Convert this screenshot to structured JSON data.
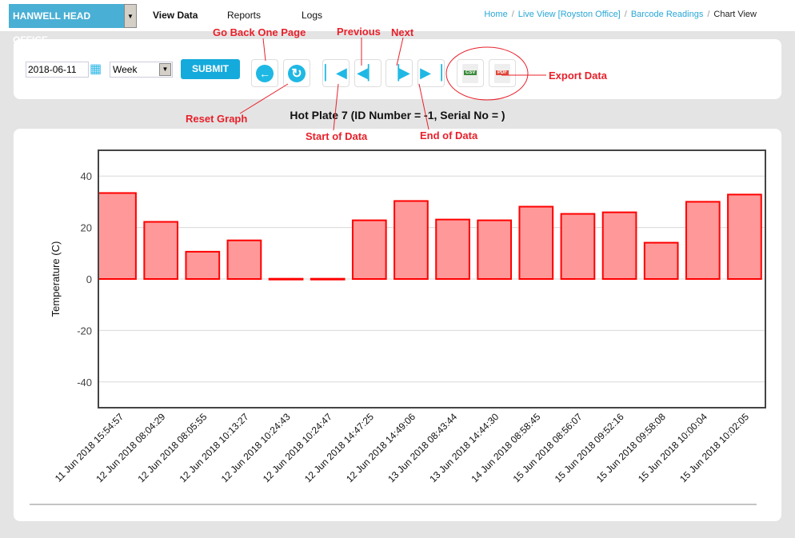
{
  "header": {
    "site": "HANWELL HEAD OFFICE",
    "nav": [
      "View Data",
      "Reports",
      "Logs"
    ],
    "breadcrumb": [
      "Home",
      "Live View [Royston Office]",
      "Barcode Readings",
      "Chart View"
    ]
  },
  "toolbar": {
    "date": "2018-06-11",
    "period": "Week",
    "submit": "SUBMIT",
    "csv": "CSV",
    "pdf": "PDF"
  },
  "annotations": {
    "back": "Go Back One Page",
    "previous": "Previous",
    "next": "Next",
    "export": "Export Data",
    "reset": "Reset Graph",
    "start": "Start of Data",
    "end": "End of Data"
  },
  "chart_data": {
    "type": "bar",
    "title": "Hot Plate 7 (ID Number = -1, Serial No = )",
    "ylabel": "Temperature (C)",
    "xlabel": "",
    "ylim": [
      -50,
      50
    ],
    "yticks": [
      40,
      20,
      0,
      -20,
      -40
    ],
    "grid": true,
    "color": "#ff9999",
    "edge": "#ff0000",
    "categories": [
      "11 Jun 2018 15:54:57",
      "12 Jun 2018 08:04:29",
      "12 Jun 2018 08:05:55",
      "12 Jun 2018 10:13:27",
      "12 Jun 2018 10:24:43",
      "12 Jun 2018 10:24:47",
      "12 Jun 2018 14:47:25",
      "12 Jun 2018 14:49:06",
      "13 Jun 2018 08:43:44",
      "13 Jun 2018 14:44:30",
      "14 Jun 2018 08:58:45",
      "15 Jun 2018 08:56:07",
      "15 Jun 2018 09:52:16",
      "15 Jun 2018 09:58:08",
      "15 Jun 2018 10:00:04",
      "15 Jun 2018 10:02:05"
    ],
    "values": [
      33.4,
      22.2,
      10.6,
      15.0,
      0.1,
      0.1,
      22.8,
      30.3,
      23.1,
      22.8,
      28.1,
      25.3,
      25.9,
      14.1,
      30.0,
      32.8
    ]
  }
}
